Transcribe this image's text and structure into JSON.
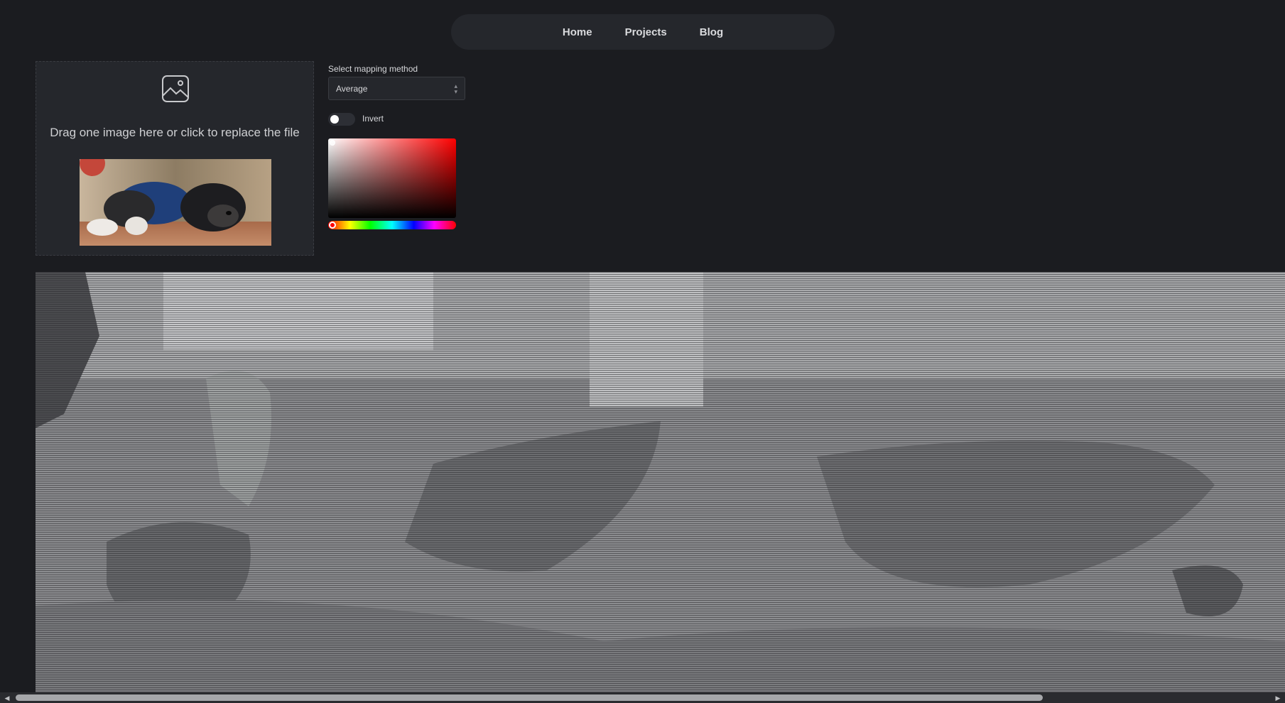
{
  "nav": {
    "items": [
      "Home",
      "Projects",
      "Blog"
    ]
  },
  "dropzone": {
    "icon": "image-icon",
    "text": "Drag one image here or click to replace the file"
  },
  "controls": {
    "mapping_label": "Select mapping method",
    "mapping_value": "Average",
    "invert_label": "Invert",
    "invert_on": false,
    "color_picker": {
      "selected_hue": "#ff0000",
      "selected_color": "#ffffff"
    }
  },
  "scrollbar": {
    "left_icon": "arrow-left-icon",
    "right_icon": "arrow-right-icon"
  }
}
